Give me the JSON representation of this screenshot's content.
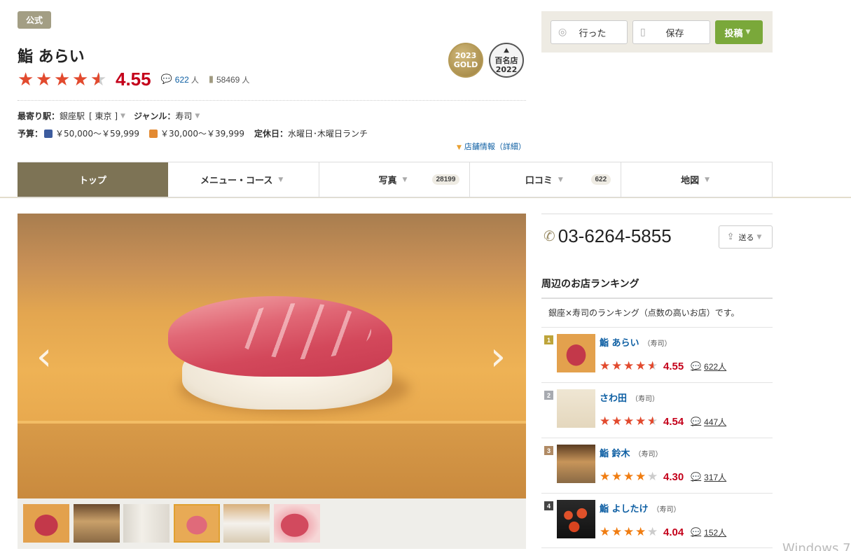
{
  "header": {
    "official_badge": "公式",
    "store_name": "鮨 あらい",
    "rating": "4.55",
    "rating_fraction": 0.91,
    "review_count": "622",
    "review_unit": "人",
    "save_count": "58469",
    "save_unit": "人",
    "award_gold_year": "2023",
    "award_gold_label": "GOLD",
    "award_hyakumeiten_label": "百名店",
    "award_hyakumeiten_year": "2022"
  },
  "info": {
    "station_label": "最寄り駅：",
    "station_value": "銀座駅",
    "area_value": "[ 東京 ]",
    "genre_label": "ジャンル：",
    "genre_value": "寿司",
    "budget_label": "予算：",
    "budget_dinner": "￥50,000～￥59,999",
    "budget_lunch": "￥30,000～￥39,999",
    "holiday_label": "定休日：",
    "holiday_value": "水曜日･木曜日ランチ",
    "detail_link": "店舗情報（詳細）"
  },
  "actions": {
    "visited": "行った",
    "save": "保存",
    "post": "投稿"
  },
  "tabs": [
    {
      "label": "トップ",
      "count": ""
    },
    {
      "label": "メニュー・コース",
      "count": ""
    },
    {
      "label": "写真",
      "count": "28199"
    },
    {
      "label": "口コミ",
      "count": "622"
    },
    {
      "label": "地図",
      "count": ""
    }
  ],
  "phone": "03-6264-5855",
  "send_label": "送る",
  "ranking": {
    "title": "周辺のお店ランキング",
    "description": "銀座×寿司のランキング（点数の高いお店）です。",
    "items": [
      {
        "rank": "1",
        "name": "鮨 あらい",
        "genre": "（寿司）",
        "score": "4.55",
        "reviews": "622人"
      },
      {
        "rank": "2",
        "name": "さわ田",
        "genre": "（寿司）",
        "score": "4.54",
        "reviews": "447人"
      },
      {
        "rank": "3",
        "name": "鮨 鈴木",
        "genre": "（寿司）",
        "score": "4.30",
        "reviews": "317人"
      },
      {
        "rank": "4",
        "name": "鮨 よしたけ",
        "genre": "（寿司）",
        "score": "4.04",
        "reviews": "152人"
      }
    ]
  },
  "watermark": "Windows 7",
  "colors": {
    "accent_red": "#c4001a",
    "tab_active": "#7d7355",
    "post_green": "#7aa83a",
    "star_red": "#e24a2e",
    "star_orange": "#f07d12"
  }
}
